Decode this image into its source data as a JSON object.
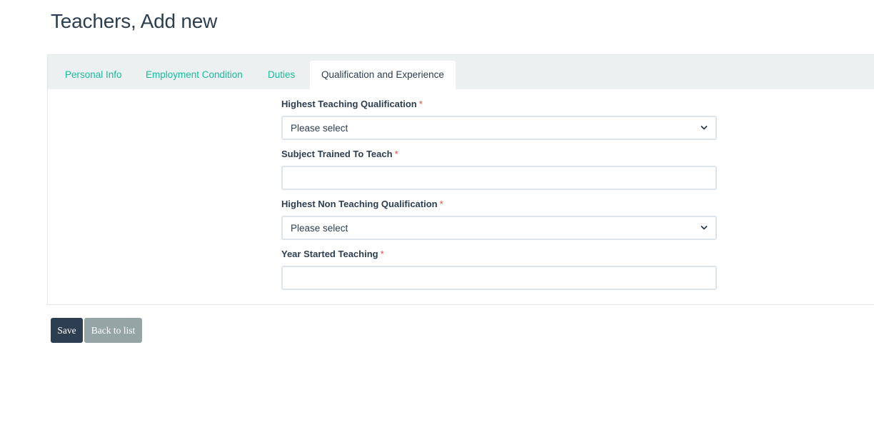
{
  "page": {
    "title": "Teachers, Add new"
  },
  "tabs": [
    {
      "label": "Personal Info",
      "active": false
    },
    {
      "label": "Employment Condition",
      "active": false
    },
    {
      "label": "Duties",
      "active": false
    },
    {
      "label": "Qualification and Experience",
      "active": true
    }
  ],
  "form": {
    "required_marker": "*",
    "highest_teaching_qualification": {
      "label": "Highest Teaching Qualification",
      "value": "Please select"
    },
    "subject_trained_to_teach": {
      "label": "Subject Trained To Teach",
      "value": ""
    },
    "highest_non_teaching_qualification": {
      "label": "Highest Non Teaching Qualification",
      "value": "Please select"
    },
    "year_started_teaching": {
      "label": "Year Started Teaching",
      "value": ""
    }
  },
  "actions": {
    "save_label": "Save",
    "back_label": "Back to list"
  },
  "colors": {
    "primary": "#2c3e50",
    "accent": "#18bc9c",
    "secondary": "#95a5a6",
    "danger": "#e74c3c"
  },
  "icons": {
    "select_arrow": "chevron-down-icon"
  }
}
